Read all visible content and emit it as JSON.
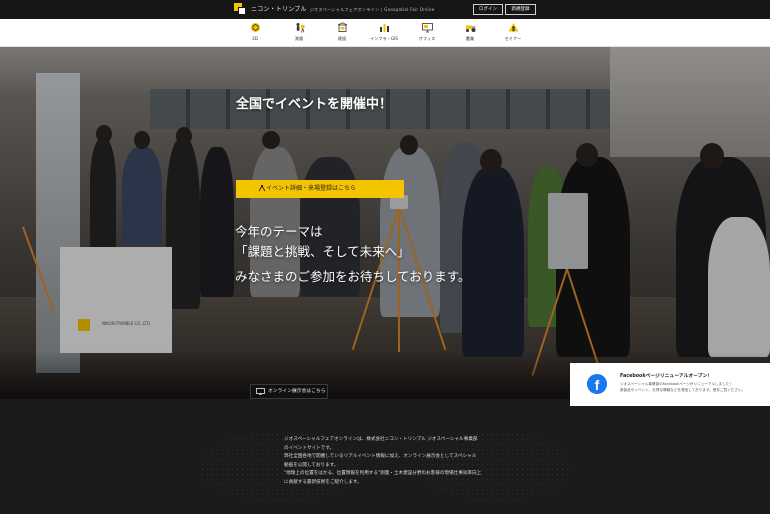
{
  "header": {
    "brand": "ニコン・トリンブル",
    "brand_sub": "ジオスペーシャルフェアオンライン | Geospatial Fair Online",
    "login_label": "ログイン",
    "register_label": "新規登録"
  },
  "nav": {
    "items": [
      {
        "label": "3D",
        "icon": "cube-icon"
      },
      {
        "label": "測量",
        "icon": "survey-person-icon"
      },
      {
        "label": "建設",
        "icon": "construction-icon"
      },
      {
        "label": "インフラ・GIS",
        "icon": "infrastructure-icon"
      },
      {
        "label": "オフィス",
        "icon": "monitor-icon"
      },
      {
        "label": "農業",
        "icon": "tractor-icon"
      },
      {
        "label": "セミナー",
        "icon": "seminar-icon"
      }
    ]
  },
  "hero": {
    "title": "全国でイベントを開催中！",
    "event_button": "イベント詳細・来場登録はこちら",
    "line1": "今年のテーマは",
    "line2": "「課題と挑戦、そして未来へ」",
    "line3": "みなさまのご参加をお待ちしております。",
    "online_button": "オンライン展示会はこちら"
  },
  "facebook": {
    "title": "Facebookページリニューアルオープン！",
    "body_line1": "ジオスペーシャル事業部のfacebookページがリニューアルしました！",
    "body_line2": "新製品やイベント、お得な情報などを発信しております。是非ご覧ください。"
  },
  "intro": {
    "lines": [
      "ジオスペーシャルフェアオンラインは、株式会社ニコン・トリンブル ジオスペーシャル事業部",
      "のイベントサイトです。",
      "弊社全国各地で開催しているリアルイベント情報に加え、オンライン展示会としてスペシャル",
      "動画を公開しております。",
      "\"地球上の位置をはかる、位置情報を利用する\"測量・土木建設分野のお客様の現場仕事効率向上",
      "に貢献する最新技術をご紹介します。"
    ]
  },
  "colors": {
    "accent": "#f5c400",
    "facebook": "#1877f2",
    "header_bg": "#161616",
    "footer_bg": "#1b1b1b"
  }
}
